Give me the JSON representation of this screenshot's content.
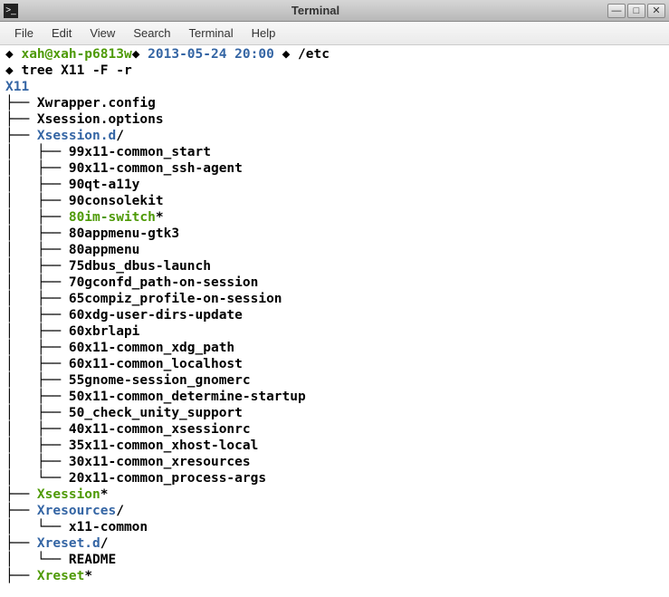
{
  "window": {
    "title": "Terminal"
  },
  "menu": {
    "items": [
      "File",
      "Edit",
      "View",
      "Search",
      "Terminal",
      "Help"
    ]
  },
  "prompt": {
    "diamond1": "◆ ",
    "userhost": "xah@xah-p6813w",
    "diamond2": "◆ ",
    "datetime": "2013-05-24 20:00",
    "diamond3": " ◆ ",
    "cwd": "/etc",
    "diamond4": "◆ ",
    "command": "tree X11 -F -r"
  },
  "tree": {
    "root": "X11",
    "lines": [
      {
        "prefix": "├── ",
        "text": "Xwrapper.config",
        "cls": ""
      },
      {
        "prefix": "├── ",
        "text": "Xsession.options",
        "cls": ""
      },
      {
        "prefix": "├── ",
        "text": "Xsession.d",
        "suffix": "/",
        "cls": "blue"
      },
      {
        "prefix": "│   ├── ",
        "text": "99x11-common_start",
        "cls": ""
      },
      {
        "prefix": "│   ├── ",
        "text": "90x11-common_ssh-agent",
        "cls": ""
      },
      {
        "prefix": "│   ├── ",
        "text": "90qt-a11y",
        "cls": ""
      },
      {
        "prefix": "│   ├── ",
        "text": "90consolekit",
        "cls": ""
      },
      {
        "prefix": "│   ├── ",
        "text": "80im-switch",
        "suffix": "*",
        "cls": "green"
      },
      {
        "prefix": "│   ├── ",
        "text": "80appmenu-gtk3",
        "cls": ""
      },
      {
        "prefix": "│   ├── ",
        "text": "80appmenu",
        "cls": ""
      },
      {
        "prefix": "│   ├── ",
        "text": "75dbus_dbus-launch",
        "cls": ""
      },
      {
        "prefix": "│   ├── ",
        "text": "70gconfd_path-on-session",
        "cls": ""
      },
      {
        "prefix": "│   ├── ",
        "text": "65compiz_profile-on-session",
        "cls": ""
      },
      {
        "prefix": "│   ├── ",
        "text": "60xdg-user-dirs-update",
        "cls": ""
      },
      {
        "prefix": "│   ├── ",
        "text": "60xbrlapi",
        "cls": ""
      },
      {
        "prefix": "│   ├── ",
        "text": "60x11-common_xdg_path",
        "cls": ""
      },
      {
        "prefix": "│   ├── ",
        "text": "60x11-common_localhost",
        "cls": ""
      },
      {
        "prefix": "│   ├── ",
        "text": "55gnome-session_gnomerc",
        "cls": ""
      },
      {
        "prefix": "│   ├── ",
        "text": "50x11-common_determine-startup",
        "cls": ""
      },
      {
        "prefix": "│   ├── ",
        "text": "50_check_unity_support",
        "cls": ""
      },
      {
        "prefix": "│   ├── ",
        "text": "40x11-common_xsessionrc",
        "cls": ""
      },
      {
        "prefix": "│   ├── ",
        "text": "35x11-common_xhost-local",
        "cls": ""
      },
      {
        "prefix": "│   ├── ",
        "text": "30x11-common_xresources",
        "cls": ""
      },
      {
        "prefix": "│   └── ",
        "text": "20x11-common_process-args",
        "cls": ""
      },
      {
        "prefix": "├── ",
        "text": "Xsession",
        "suffix": "*",
        "cls": "green"
      },
      {
        "prefix": "├── ",
        "text": "Xresources",
        "suffix": "/",
        "cls": "blue"
      },
      {
        "prefix": "│   └── ",
        "text": "x11-common",
        "cls": ""
      },
      {
        "prefix": "├── ",
        "text": "Xreset.d",
        "suffix": "/",
        "cls": "blue"
      },
      {
        "prefix": "│   └── ",
        "text": "README",
        "cls": ""
      },
      {
        "prefix": "├── ",
        "text": "Xreset",
        "suffix": "*",
        "cls": "green"
      }
    ]
  }
}
